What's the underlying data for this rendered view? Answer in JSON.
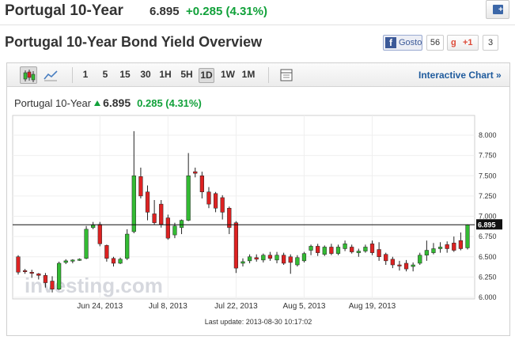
{
  "header": {
    "instrument": "Portugal 10-Year",
    "price": "6.895",
    "change": "+0.285 (4.31%)",
    "overview_title": "Portugal 10-Year Bond Yield Overview"
  },
  "social": {
    "facebook_label": "Gosto",
    "facebook_count": "56",
    "gplus_label": "+1",
    "gplus_count": "3"
  },
  "toolbar": {
    "timeframes": [
      "1",
      "5",
      "15",
      "30",
      "1H",
      "5H",
      "1D",
      "1W",
      "1M"
    ],
    "selected_timeframe": "1D",
    "interactive_label": "Interactive Chart »"
  },
  "quote": {
    "name": "Portugal 10-Year",
    "value": "6.895",
    "change": "0.285 (4.31%)"
  },
  "watermark": "investing.com",
  "last_update": "Last update: 2013-08-30 10:17:02",
  "colors": {
    "up": "#33bb33",
    "down": "#dd2222",
    "positive_text": "#11a13a",
    "link": "#1f5b9d"
  },
  "chart_data": {
    "type": "candlestick",
    "ylim": [
      6.0,
      8.1
    ],
    "y_ticks": [
      "8.000",
      "7.750",
      "7.500",
      "7.250",
      "7.000",
      "6.750",
      "6.500",
      "6.250",
      "6.000"
    ],
    "x_ticks": [
      {
        "label": "Jun 24, 2013",
        "index": 12
      },
      {
        "label": "Jul 8, 2013",
        "index": 22
      },
      {
        "label": "Jul 22, 2013",
        "index": 32
      },
      {
        "label": "Aug 5, 2013",
        "index": 42
      },
      {
        "label": "Aug 19, 2013",
        "index": 52
      }
    ],
    "last_price": 6.895,
    "last_price_label": "6.895",
    "candles": [
      {
        "o": 6.5,
        "h": 6.52,
        "l": 6.28,
        "c": 6.31
      },
      {
        "o": 6.33,
        "h": 6.35,
        "l": 6.29,
        "c": 6.32
      },
      {
        "o": 6.31,
        "h": 6.34,
        "l": 6.24,
        "c": 6.3
      },
      {
        "o": 6.29,
        "h": 6.3,
        "l": 6.22,
        "c": 6.27
      },
      {
        "o": 6.27,
        "h": 6.3,
        "l": 6.12,
        "c": 6.18
      },
      {
        "o": 6.2,
        "h": 6.26,
        "l": 6.06,
        "c": 6.1
      },
      {
        "o": 6.1,
        "h": 6.44,
        "l": 6.09,
        "c": 6.42
      },
      {
        "o": 6.43,
        "h": 6.47,
        "l": 6.41,
        "c": 6.45
      },
      {
        "o": 6.45,
        "h": 6.47,
        "l": 6.42,
        "c": 6.46
      },
      {
        "o": 6.46,
        "h": 6.48,
        "l": 6.45,
        "c": 6.47
      },
      {
        "o": 6.48,
        "h": 6.88,
        "l": 6.47,
        "c": 6.84
      },
      {
        "o": 6.86,
        "h": 6.93,
        "l": 6.84,
        "c": 6.89
      },
      {
        "o": 6.9,
        "h": 6.93,
        "l": 6.63,
        "c": 6.66
      },
      {
        "o": 6.64,
        "h": 6.65,
        "l": 6.44,
        "c": 6.48
      },
      {
        "o": 6.48,
        "h": 6.5,
        "l": 6.38,
        "c": 6.42
      },
      {
        "o": 6.42,
        "h": 6.49,
        "l": 6.41,
        "c": 6.47
      },
      {
        "o": 6.48,
        "h": 6.84,
        "l": 6.46,
        "c": 6.78
      },
      {
        "o": 6.81,
        "h": 8.05,
        "l": 6.79,
        "c": 7.5
      },
      {
        "o": 7.49,
        "h": 7.6,
        "l": 7.22,
        "c": 7.25
      },
      {
        "o": 7.3,
        "h": 7.38,
        "l": 6.95,
        "c": 7.05
      },
      {
        "o": 7.03,
        "h": 7.2,
        "l": 6.9,
        "c": 6.92
      },
      {
        "o": 7.15,
        "h": 7.2,
        "l": 6.86,
        "c": 6.9
      },
      {
        "o": 6.98,
        "h": 7.02,
        "l": 6.71,
        "c": 6.73
      },
      {
        "o": 6.77,
        "h": 6.92,
        "l": 6.73,
        "c": 6.88
      },
      {
        "o": 6.86,
        "h": 6.96,
        "l": 6.78,
        "c": 6.95
      },
      {
        "o": 6.95,
        "h": 7.78,
        "l": 6.94,
        "c": 7.5
      },
      {
        "o": 7.55,
        "h": 7.6,
        "l": 7.48,
        "c": 7.53
      },
      {
        "o": 7.5,
        "h": 7.55,
        "l": 7.22,
        "c": 7.3
      },
      {
        "o": 7.3,
        "h": 7.36,
        "l": 7.1,
        "c": 7.15
      },
      {
        "o": 7.28,
        "h": 7.3,
        "l": 7.05,
        "c": 7.1
      },
      {
        "o": 7.23,
        "h": 7.26,
        "l": 6.96,
        "c": 7.05
      },
      {
        "o": 7.1,
        "h": 7.12,
        "l": 6.78,
        "c": 6.86
      },
      {
        "o": 6.92,
        "h": 6.94,
        "l": 6.3,
        "c": 6.36
      },
      {
        "o": 6.42,
        "h": 6.48,
        "l": 6.38,
        "c": 6.44
      },
      {
        "o": 6.45,
        "h": 6.53,
        "l": 6.42,
        "c": 6.5
      },
      {
        "o": 6.49,
        "h": 6.53,
        "l": 6.44,
        "c": 6.47
      },
      {
        "o": 6.46,
        "h": 6.54,
        "l": 6.43,
        "c": 6.52
      },
      {
        "o": 6.52,
        "h": 6.56,
        "l": 6.45,
        "c": 6.48
      },
      {
        "o": 6.46,
        "h": 6.56,
        "l": 6.42,
        "c": 6.52
      },
      {
        "o": 6.52,
        "h": 6.55,
        "l": 6.4,
        "c": 6.42
      },
      {
        "o": 6.5,
        "h": 6.53,
        "l": 6.29,
        "c": 6.43
      },
      {
        "o": 6.4,
        "h": 6.52,
        "l": 6.38,
        "c": 6.49
      },
      {
        "o": 6.45,
        "h": 6.56,
        "l": 6.43,
        "c": 6.54
      },
      {
        "o": 6.58,
        "h": 6.65,
        "l": 6.52,
        "c": 6.63
      },
      {
        "o": 6.63,
        "h": 6.66,
        "l": 6.51,
        "c": 6.55
      },
      {
        "o": 6.53,
        "h": 6.64,
        "l": 6.51,
        "c": 6.62
      },
      {
        "o": 6.62,
        "h": 6.66,
        "l": 6.52,
        "c": 6.54
      },
      {
        "o": 6.54,
        "h": 6.65,
        "l": 6.52,
        "c": 6.62
      },
      {
        "o": 6.6,
        "h": 6.7,
        "l": 6.57,
        "c": 6.66
      },
      {
        "o": 6.62,
        "h": 6.65,
        "l": 6.54,
        "c": 6.56
      },
      {
        "o": 6.55,
        "h": 6.6,
        "l": 6.5,
        "c": 6.57
      },
      {
        "o": 6.57,
        "h": 6.65,
        "l": 6.55,
        "c": 6.62
      },
      {
        "o": 6.66,
        "h": 6.7,
        "l": 6.52,
        "c": 6.55
      },
      {
        "o": 6.59,
        "h": 6.68,
        "l": 6.45,
        "c": 6.5
      },
      {
        "o": 6.53,
        "h": 6.55,
        "l": 6.4,
        "c": 6.45
      },
      {
        "o": 6.47,
        "h": 6.5,
        "l": 6.36,
        "c": 6.4
      },
      {
        "o": 6.4,
        "h": 6.45,
        "l": 6.33,
        "c": 6.39
      },
      {
        "o": 6.42,
        "h": 6.46,
        "l": 6.32,
        "c": 6.35
      },
      {
        "o": 6.38,
        "h": 6.43,
        "l": 6.32,
        "c": 6.4
      },
      {
        "o": 6.42,
        "h": 6.55,
        "l": 6.4,
        "c": 6.52
      },
      {
        "o": 6.52,
        "h": 6.7,
        "l": 6.45,
        "c": 6.58
      },
      {
        "o": 6.55,
        "h": 6.67,
        "l": 6.53,
        "c": 6.6
      },
      {
        "o": 6.6,
        "h": 6.68,
        "l": 6.55,
        "c": 6.62
      },
      {
        "o": 6.65,
        "h": 6.69,
        "l": 6.55,
        "c": 6.6
      },
      {
        "o": 6.67,
        "h": 6.75,
        "l": 6.56,
        "c": 6.58
      },
      {
        "o": 6.7,
        "h": 6.8,
        "l": 6.58,
        "c": 6.6
      },
      {
        "o": 6.61,
        "h": 6.9,
        "l": 6.59,
        "c": 6.895
      }
    ]
  }
}
